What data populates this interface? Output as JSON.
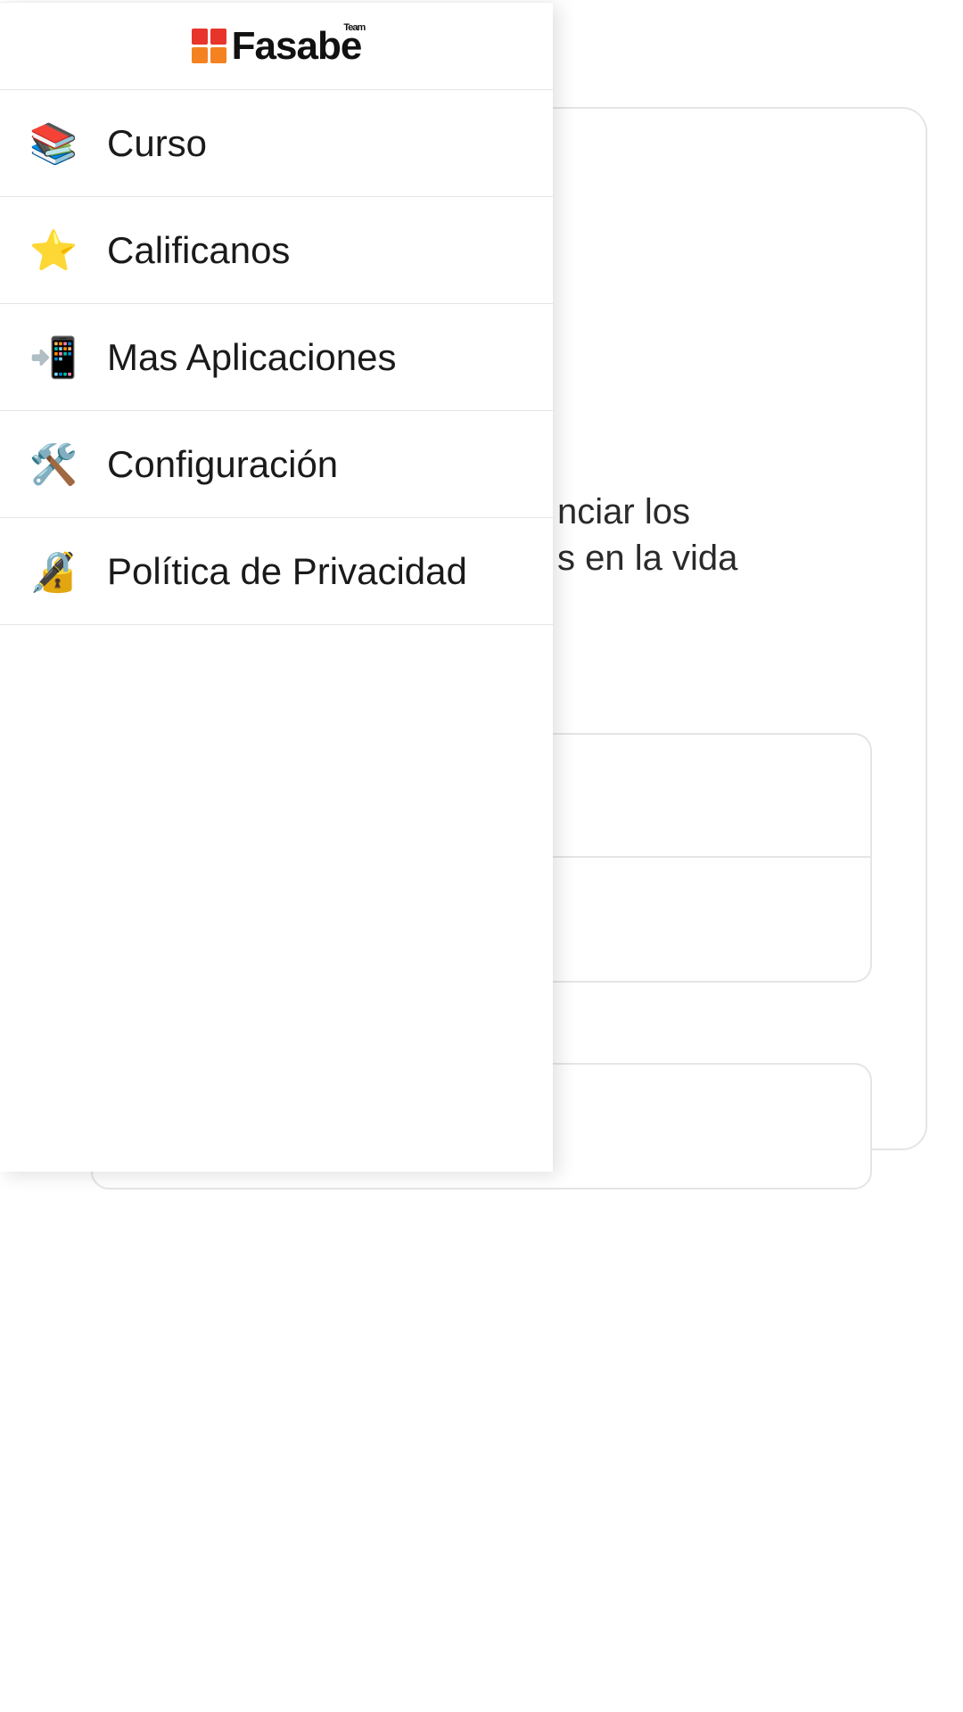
{
  "logo": {
    "brand": "Fasabe",
    "tagline": "Team"
  },
  "background": {
    "line1": "nciar los",
    "line2": "s en la vida"
  },
  "menu": {
    "items": [
      {
        "label": "Curso",
        "icon": "📚"
      },
      {
        "label": "Calificanos",
        "icon": "⭐"
      },
      {
        "label": "Mas Aplicaciones",
        "icon": "📲"
      },
      {
        "label": "Configuración",
        "icon": "🛠️"
      },
      {
        "label": "Política de Privacidad",
        "icon": "🔏"
      }
    ]
  }
}
